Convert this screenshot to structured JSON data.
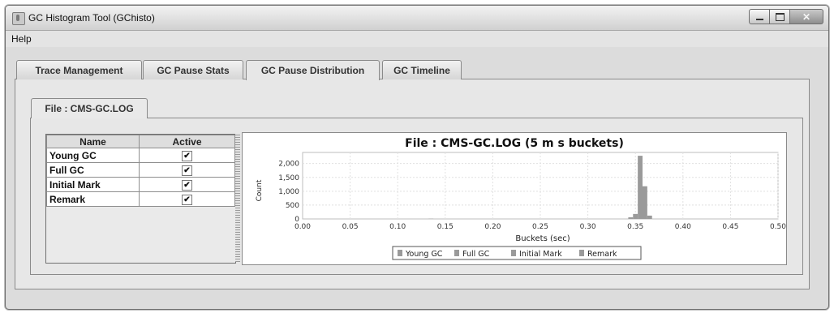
{
  "window": {
    "title": "GC Histogram Tool (GChisto)"
  },
  "menu": {
    "help": "Help"
  },
  "tabs": [
    {
      "label": "Trace Management"
    },
    {
      "label": "GC Pause Stats"
    },
    {
      "label": "GC Pause Distribution",
      "active": true
    },
    {
      "label": "GC Timeline"
    }
  ],
  "subtab": {
    "label": "File : CMS-GC.LOG"
  },
  "table": {
    "headers": [
      "Name",
      "Active"
    ],
    "rows": [
      {
        "name": "Young GC",
        "active": true
      },
      {
        "name": "Full GC",
        "active": true
      },
      {
        "name": "Initial Mark",
        "active": true
      },
      {
        "name": "Remark",
        "active": true
      }
    ],
    "check_glyph": "✔"
  },
  "chart_data": {
    "type": "bar",
    "title": "File : CMS-GC.LOG (5 m s buckets)",
    "xlabel": "Buckets (sec)",
    "ylabel": "Count",
    "xlim": [
      0.0,
      0.5
    ],
    "ylim": [
      0,
      2400
    ],
    "x_ticks": [
      "0.00",
      "0.05",
      "0.10",
      "0.15",
      "0.20",
      "0.25",
      "0.30",
      "0.35",
      "0.40",
      "0.45",
      "0.50"
    ],
    "y_ticks": [
      "0",
      "500",
      "1,000",
      "1,500",
      "2,000"
    ],
    "grid": true,
    "legend_position": "bottom",
    "legend": [
      "Young GC",
      "Full GC",
      "Initial Mark",
      "Remark"
    ],
    "bar_color": "#9a9a9a",
    "series": [
      {
        "name": "Young GC",
        "x": [
          0.135,
          0.345,
          0.35,
          0.355,
          0.36,
          0.365
        ],
        "values": [
          8,
          60,
          180,
          2280,
          1180,
          120
        ]
      }
    ]
  }
}
